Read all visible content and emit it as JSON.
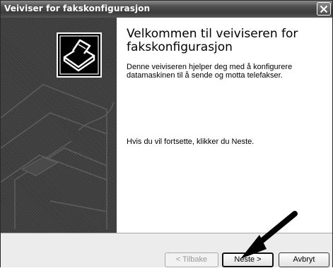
{
  "window": {
    "title": "Veiviser for fakskonfigurasjon",
    "close_icon": "close-icon"
  },
  "side_panel": {
    "icon": "fax-printer-icon"
  },
  "main": {
    "heading": "Velkommen til veiviseren for fakskonfigurasjon",
    "description": "Denne veiviseren hjelper deg med å konfigurere datamaskinen til å sende og motta telefakser.",
    "continue_text": "Hvis du vil fortsette, klikker du Neste."
  },
  "buttons": {
    "back_label": "< Tilbake",
    "next_label": "Neste >",
    "cancel_label": "Avbryt"
  },
  "annotation": {
    "icon": "pointer-arrow-icon"
  }
}
